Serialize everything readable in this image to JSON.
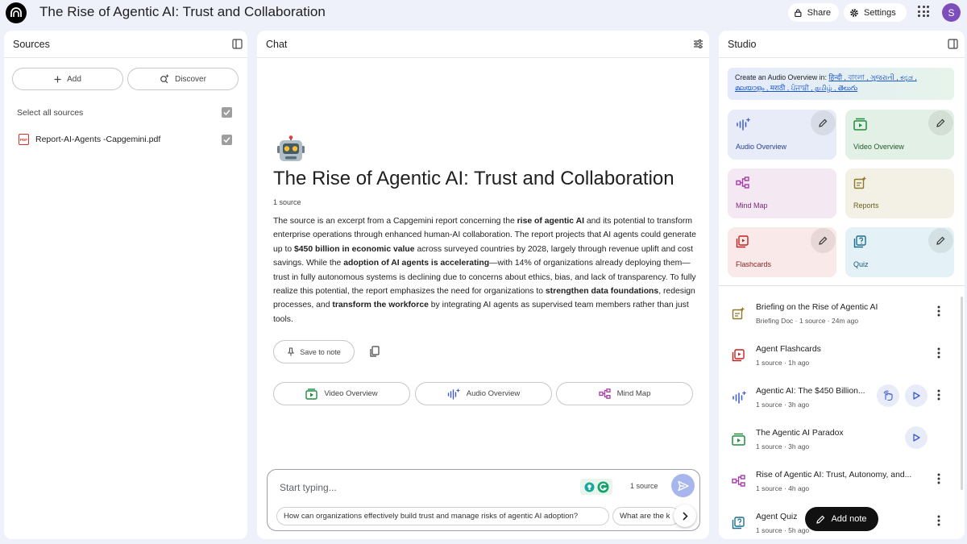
{
  "app": {
    "title": "The Rise of Agentic AI: Trust and Collaboration",
    "avatar_letter": "S"
  },
  "topbar": {
    "share_label": "Share",
    "settings_label": "Settings"
  },
  "sources": {
    "title": "Sources",
    "add_label": "Add",
    "discover_label": "Discover",
    "select_all_label": "Select all sources",
    "files": [
      {
        "name": "Report-AI-Agents -Capgemini.pdf",
        "type": "PDF",
        "checked": true
      }
    ]
  },
  "chat": {
    "title": "Chat",
    "notebook_title": "The Rise of Agentic AI: Trust and Collaboration",
    "source_count": "1 source",
    "summary": {
      "s1": "The source is an excerpt from a Capgemini report concerning the ",
      "b1": "rise of agentic AI",
      "s2": " and its potential to transform enterprise operations through enhanced human-AI collaboration. The report projects that AI agents could generate up to ",
      "b2": "$450 billion in economic value",
      "s3": " across surveyed countries by 2028, largely through revenue uplift and cost savings. While the ",
      "b3": "adoption of AI agents is accelerating",
      "s4": "—with 14% of organizations already deploying them—trust in fully autonomous systems is declining due to concerns about ethics, bias, and lack of transparency. To fully realize this potential, the report emphasizes the need for organizations to ",
      "b4": "strengthen data foundations",
      "s5": ", redesign processes, and ",
      "b5": "transform the workforce",
      "s6": " by integrating AI agents as supervised team members rather than just tools."
    },
    "save_to_note_label": "Save to note",
    "actions": {
      "video": "Video Overview",
      "audio": "Audio Overview",
      "mindmap": "Mind Map"
    },
    "composer": {
      "placeholder": "Start typing...",
      "source_count": "1 source",
      "suggestions": [
        "How can organizations effectively build trust and manage risks of agentic AI adoption?",
        "What are the k"
      ]
    }
  },
  "studio": {
    "title": "Studio",
    "audio_banner_prefix": "Create an Audio Overview in:",
    "audio_banner_langs_1": "हिन्दी , বাংলা , ગુજરાતી , ಕನ್ನಡ ,",
    "audio_banner_langs_2": "മലയാളം , मराठी , ਪੰਜਾਬੀ , தமிழ் , తెలుగు",
    "tiles": {
      "audio": "Audio Overview",
      "video": "Video Overview",
      "mindmap": "Mind Map",
      "reports": "Reports",
      "flashcards": "Flashcards",
      "quiz": "Quiz"
    },
    "notes": [
      {
        "title": "Briefing on the Rise of Agentic AI",
        "meta": "Briefing Doc · 1 source · 24m ago"
      },
      {
        "title": "Agent Flashcards",
        "meta": "1 source · 1h ago"
      },
      {
        "title": "Agentic AI: The $450 Billion...",
        "meta": "1 source · 3h ago"
      },
      {
        "title": "The Agentic AI Paradox",
        "meta": "1 source · 3h ago"
      },
      {
        "title": "Rise of Agentic AI: Trust, Autonomy, and...",
        "meta": "1 source · 4h ago"
      },
      {
        "title": "Agent Quiz",
        "meta": "1 source · 5h ago"
      }
    ],
    "add_note_label": "Add note"
  },
  "colors": {
    "audio_tile": "#e8ecf8",
    "video_tile": "#e3f0e5",
    "mindmap_tile": "#f4e9f3",
    "reports_tile": "#f3f1e6",
    "flashcards_tile": "#f9e9e8",
    "quiz_tile": "#e4f1f6",
    "send_button": "#a8b6ee",
    "page_background": "#eef1fa"
  }
}
